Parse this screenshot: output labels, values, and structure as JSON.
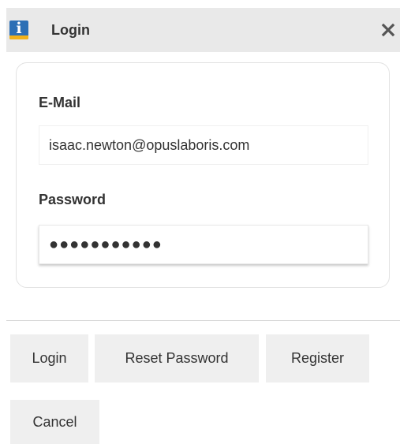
{
  "window": {
    "title": "Login",
    "icon": "app-logo-icon",
    "close_icon": "close-icon"
  },
  "form": {
    "email": {
      "label": "E-Mail",
      "value": "isaac.newton@opuslaboris.com"
    },
    "password": {
      "label": "Password",
      "value": "●●●●●●●●●●●"
    }
  },
  "buttons": {
    "login": "Login",
    "reset_password": "Reset Password",
    "register": "Register",
    "cancel": "Cancel"
  },
  "colors": {
    "titlebar_bg": "#e9e9e9",
    "button_bg": "#efefef",
    "icon_blue": "#2c6fb5",
    "icon_yellow": "#f2b21b"
  }
}
